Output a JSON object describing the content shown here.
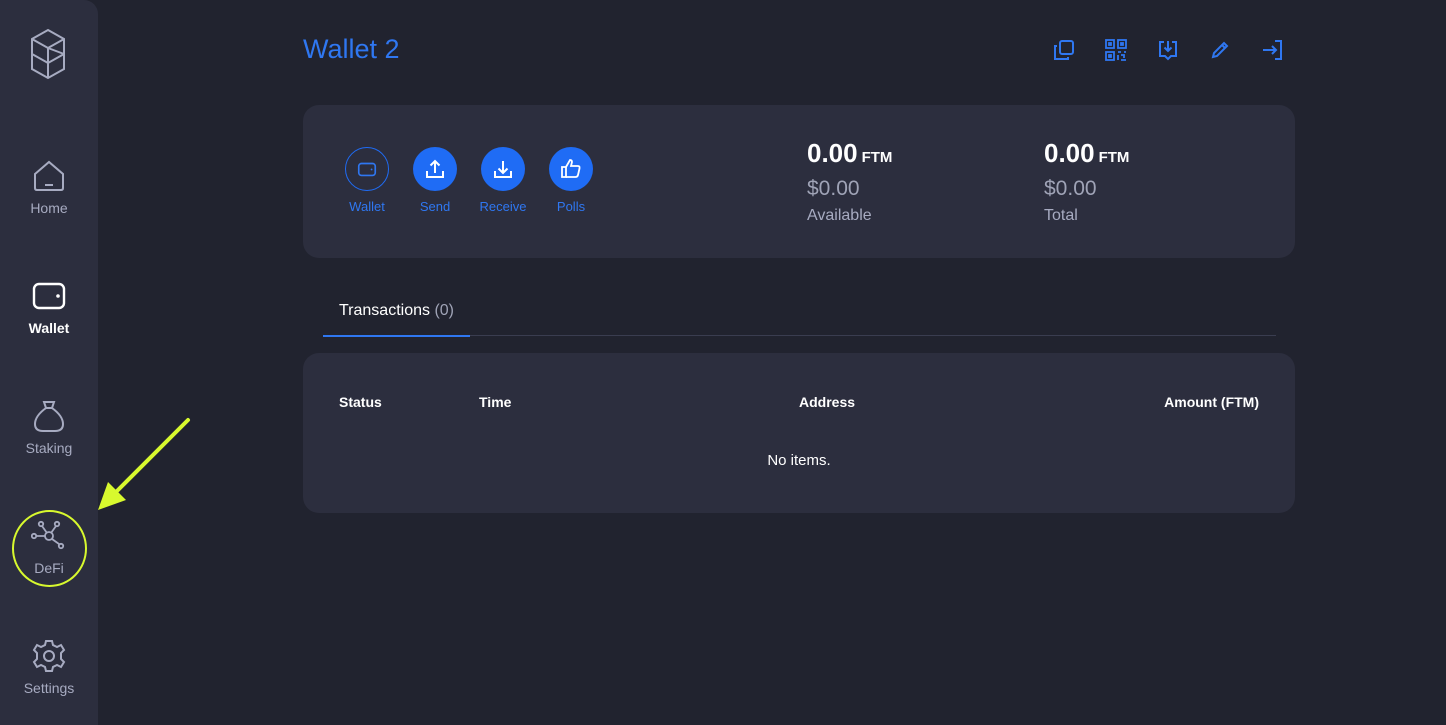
{
  "sidebar": {
    "items": [
      {
        "label": "Home",
        "icon": "home-icon"
      },
      {
        "label": "Wallet",
        "icon": "wallet-icon",
        "active": true
      },
      {
        "label": "Staking",
        "icon": "money-bag-icon"
      },
      {
        "label": "DeFi",
        "icon": "network-nodes-icon"
      },
      {
        "label": "Settings",
        "icon": "gear-icon"
      }
    ]
  },
  "header": {
    "title": "Wallet 2",
    "icons": [
      "copy-icon",
      "qr-code-icon",
      "download-icon",
      "pencil-icon",
      "logout-icon"
    ]
  },
  "actions": [
    {
      "label": "Wallet",
      "icon": "wallet-icon"
    },
    {
      "label": "Send",
      "icon": "upload-icon"
    },
    {
      "label": "Receive",
      "icon": "download-icon"
    },
    {
      "label": "Polls",
      "icon": "thumbs-up-icon"
    }
  ],
  "balances": {
    "available": {
      "amount": "0.00",
      "unit": "FTM",
      "usd": "$0.00",
      "caption": "Available"
    },
    "total": {
      "amount": "0.00",
      "unit": "FTM",
      "usd": "$0.00",
      "caption": "Total"
    }
  },
  "tabs": [
    {
      "label": "Transactions",
      "count": "(0)"
    }
  ],
  "transactions": {
    "columns": [
      "Status",
      "Time",
      "Address",
      "Amount (FTM)"
    ],
    "empty_text": "No items."
  },
  "colors": {
    "accent": "#2f77f1",
    "background": "#21232f",
    "panel": "#2c2e3e",
    "highlight": "#d8f92e"
  }
}
